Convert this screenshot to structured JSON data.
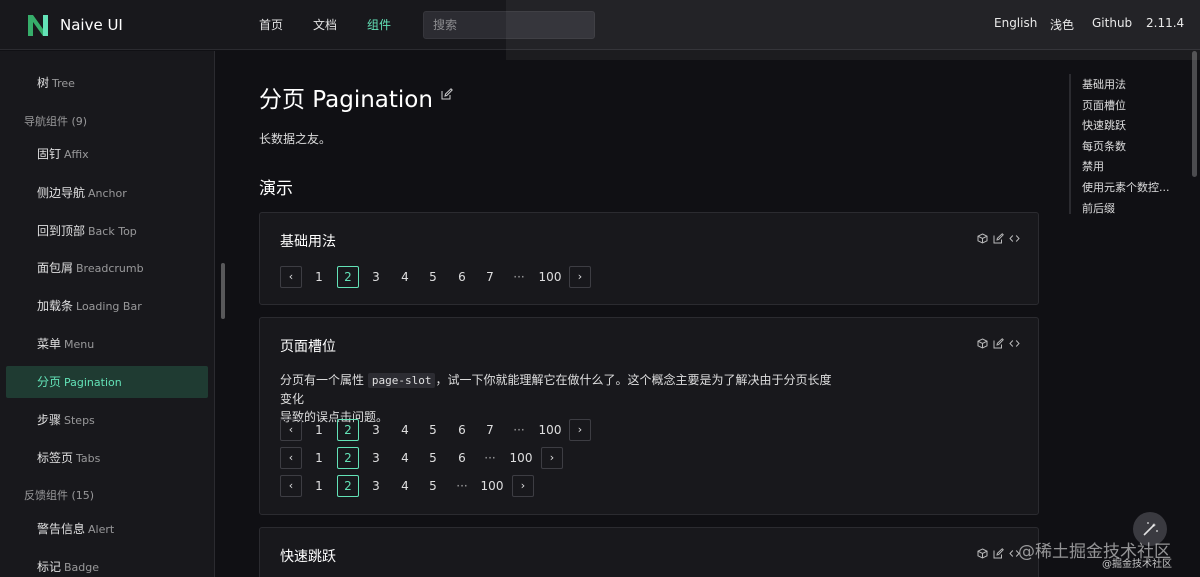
{
  "header": {
    "brand": "Naive UI",
    "nav": [
      "首页",
      "文档",
      "组件"
    ],
    "active_nav": "组件",
    "search_placeholder": "搜索",
    "right": [
      "English",
      "浅色",
      "Github",
      "2.11.4"
    ],
    "accent": "#63e2b7"
  },
  "sidebar": {
    "items": [
      {
        "type": "item",
        "zh": "树",
        "en": "Tree"
      },
      {
        "type": "group",
        "label": "导航组件 (9)"
      },
      {
        "type": "item",
        "zh": "固钉",
        "en": "Affix"
      },
      {
        "type": "item",
        "zh": "侧边导航",
        "en": "Anchor"
      },
      {
        "type": "item",
        "zh": "回到顶部",
        "en": "Back Top"
      },
      {
        "type": "item",
        "zh": "面包屑",
        "en": "Breadcrumb"
      },
      {
        "type": "item",
        "zh": "加载条",
        "en": "Loading Bar"
      },
      {
        "type": "item",
        "zh": "菜单",
        "en": "Menu"
      },
      {
        "type": "item",
        "zh": "分页",
        "en": "Pagination",
        "active": true
      },
      {
        "type": "item",
        "zh": "步骤",
        "en": "Steps"
      },
      {
        "type": "item",
        "zh": "标签页",
        "en": "Tabs"
      },
      {
        "type": "group",
        "label": "反馈组件 (15)"
      },
      {
        "type": "item",
        "zh": "警告信息",
        "en": "Alert"
      },
      {
        "type": "item",
        "zh": "标记",
        "en": "Badge"
      }
    ]
  },
  "main": {
    "title": "分页 Pagination",
    "description": "长数据之友。",
    "section_title": "演示",
    "cards": [
      {
        "title": "基础用法",
        "rows": [
          {
            "pages": [
              "1",
              "2",
              "3",
              "4",
              "5",
              "6",
              "7",
              "···",
              "100"
            ],
            "current": "2"
          }
        ]
      },
      {
        "title": "页面槽位",
        "text_before": "分页有一个属性",
        "code": "page-slot",
        "text_after": "，试一下你就能理解它在做什么了。这个概念主要是为了解决由于分页长度变化",
        "text_line2": "导致的误点击问题。",
        "rows": [
          {
            "pages": [
              "1",
              "2",
              "3",
              "4",
              "5",
              "6",
              "7",
              "···",
              "100"
            ],
            "current": "2"
          },
          {
            "pages": [
              "1",
              "2",
              "3",
              "4",
              "5",
              "6",
              "···",
              "100"
            ],
            "current": "2"
          },
          {
            "pages": [
              "1",
              "2",
              "3",
              "4",
              "5",
              "···",
              "100"
            ],
            "current": "2"
          }
        ]
      },
      {
        "title": "快速跳跃",
        "rows": []
      }
    ]
  },
  "toc": [
    "基础用法",
    "页面槽位",
    "快速跳跃",
    "每页条数",
    "禁用",
    "使用元素个数控...",
    "前后缀"
  ],
  "watermark": {
    "line1": "@稀土掘金技术社区",
    "line2": "@掘金技术社区"
  }
}
